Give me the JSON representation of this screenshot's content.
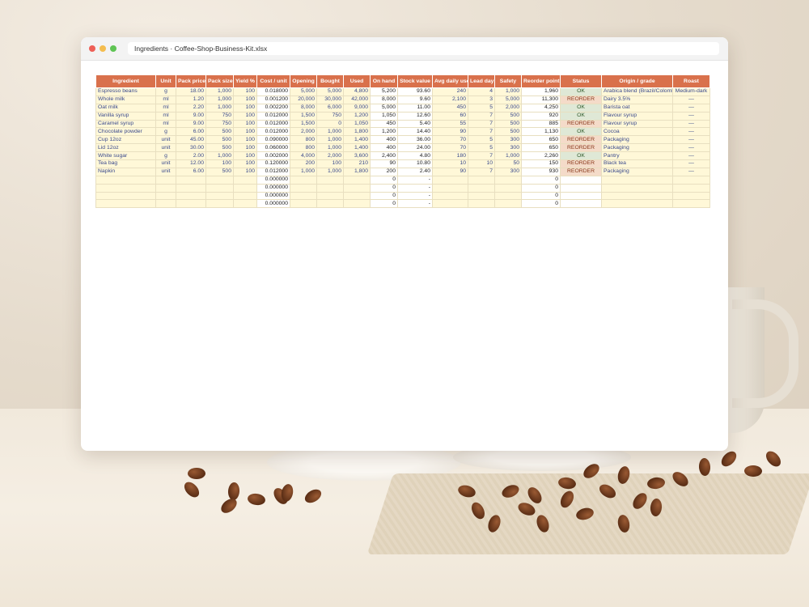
{
  "window": {
    "title": "Ingredients · Coffee-Shop-Business-Kit.xlsx"
  },
  "sheet": {
    "headers": [
      "Ingredient",
      "Unit",
      "Pack price",
      "Pack size",
      "Yield %",
      "Cost / unit",
      "Opening",
      "Bought",
      "Used",
      "On hand",
      "Stock value",
      "Avg daily use",
      "Lead days",
      "Safety",
      "Reorder point",
      "Status",
      "Origin / grade",
      "Roast"
    ],
    "rows": [
      [
        "Espresso beans",
        "g",
        "18.00",
        "1,000",
        "100",
        "0.018000",
        "5,000",
        "5,000",
        "4,800",
        "5,200",
        "93.60",
        "240",
        "4",
        "1,000",
        "1,960",
        "OK",
        "Arabica blend (Brazil/Colombia)",
        "Medium-dark"
      ],
      [
        "Whole milk",
        "ml",
        "1.20",
        "1,000",
        "100",
        "0.001200",
        "20,000",
        "30,000",
        "42,000",
        "8,000",
        "9.60",
        "2,100",
        "3",
        "5,000",
        "11,300",
        "REORDER",
        "Dairy 3.5%",
        "—"
      ],
      [
        "Oat milk",
        "ml",
        "2.20",
        "1,000",
        "100",
        "0.002200",
        "8,000",
        "6,000",
        "9,000",
        "5,000",
        "11.00",
        "450",
        "5",
        "2,000",
        "4,250",
        "OK",
        "Barista oat",
        "—"
      ],
      [
        "Vanilla syrup",
        "ml",
        "9.00",
        "750",
        "100",
        "0.012000",
        "1,500",
        "750",
        "1,200",
        "1,050",
        "12.60",
        "60",
        "7",
        "500",
        "920",
        "OK",
        "Flavour syrup",
        "—"
      ],
      [
        "Caramel syrup",
        "ml",
        "9.00",
        "750",
        "100",
        "0.012000",
        "1,500",
        "0",
        "1,050",
        "450",
        "5.40",
        "55",
        "7",
        "500",
        "885",
        "REORDER",
        "Flavour syrup",
        "—"
      ],
      [
        "Chocolate powder",
        "g",
        "6.00",
        "500",
        "100",
        "0.012000",
        "2,000",
        "1,000",
        "1,800",
        "1,200",
        "14.40",
        "90",
        "7",
        "500",
        "1,130",
        "OK",
        "Cocoa",
        "—"
      ],
      [
        "Cup 12oz",
        "unit",
        "45.00",
        "500",
        "100",
        "0.090000",
        "800",
        "1,000",
        "1,400",
        "400",
        "36.00",
        "70",
        "5",
        "300",
        "650",
        "REORDER",
        "Packaging",
        "—"
      ],
      [
        "Lid 12oz",
        "unit",
        "30.00",
        "500",
        "100",
        "0.060000",
        "800",
        "1,000",
        "1,400",
        "400",
        "24.00",
        "70",
        "5",
        "300",
        "650",
        "REORDER",
        "Packaging",
        "—"
      ],
      [
        "White sugar",
        "g",
        "2.00",
        "1,000",
        "100",
        "0.002000",
        "4,000",
        "2,000",
        "3,600",
        "2,400",
        "4.80",
        "180",
        "7",
        "1,000",
        "2,260",
        "OK",
        "Pantry",
        "—"
      ],
      [
        "Tea bag",
        "unit",
        "12.00",
        "100",
        "100",
        "0.120000",
        "200",
        "100",
        "210",
        "90",
        "10.80",
        "10",
        "10",
        "50",
        "150",
        "REORDER",
        "Black tea",
        "—"
      ],
      [
        "Napkin",
        "unit",
        "6.00",
        "500",
        "100",
        "0.012000",
        "1,000",
        "1,000",
        "1,800",
        "200",
        "2.40",
        "90",
        "7",
        "300",
        "930",
        "REORDER",
        "Packaging",
        "—"
      ],
      [
        "",
        "",
        "",
        "",
        "",
        "0.000000",
        "",
        "",
        "",
        "0",
        "-",
        "",
        "",
        "",
        "0",
        "",
        "",
        ""
      ],
      [
        "",
        "",
        "",
        "",
        "",
        "0.000000",
        "",
        "",
        "",
        "0",
        "-",
        "",
        "",
        "",
        "0",
        "",
        "",
        ""
      ],
      [
        "",
        "",
        "",
        "",
        "",
        "0.000000",
        "",
        "",
        "",
        "0",
        "-",
        "",
        "",
        "",
        "0",
        "",
        "",
        ""
      ],
      [
        "",
        "",
        "",
        "",
        "",
        "0.000000",
        "",
        "",
        "",
        "0",
        "-",
        "",
        "",
        "",
        "0",
        "",
        "",
        ""
      ]
    ]
  }
}
